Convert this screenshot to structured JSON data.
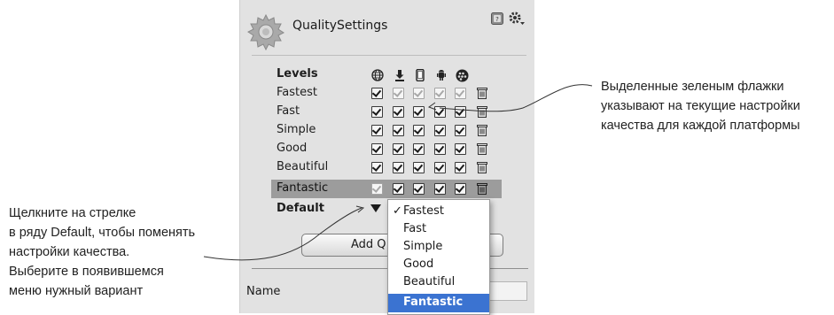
{
  "inspector": {
    "title": "QualitySettings",
    "levels_header": "Levels",
    "platform_icons": [
      "web-player-icon",
      "standalone-download-icon",
      "iphone-icon",
      "android-icon",
      "blackberry-icon"
    ],
    "levels": [
      {
        "name": "Fastest",
        "checks": [
          true,
          false,
          false,
          false,
          false
        ]
      },
      {
        "name": "Fast",
        "checks": [
          true,
          true,
          true,
          true,
          true
        ]
      },
      {
        "name": "Simple",
        "checks": [
          true,
          true,
          true,
          true,
          true
        ]
      },
      {
        "name": "Good",
        "checks": [
          true,
          true,
          true,
          true,
          true
        ]
      },
      {
        "name": "Beautiful",
        "checks": [
          true,
          true,
          true,
          true,
          true
        ]
      },
      {
        "name": "Fantastic",
        "checks": [
          false,
          true,
          true,
          true,
          true
        ],
        "highlighted": true
      }
    ],
    "default_label": "Default",
    "add_button_label": "Add Q",
    "name_label": "Name"
  },
  "dropdown": {
    "options": [
      "Fastest",
      "Fast",
      "Simple",
      "Good",
      "Beautiful",
      "Fantastic"
    ],
    "checked": "Fastest",
    "highlighted": "Fantastic",
    "checkmark": "✓",
    "highlight_color": "#3b73d1"
  },
  "annotations": {
    "right": [
      "Выделенные зеленым флажки",
      "указывают на текущие настройки",
      "качества для каждой платформы"
    ],
    "left": [
      "Щелкните на стрелке",
      "в ряду Default, чтобы поменять",
      "настройки качества.",
      "Выберите в появившемся",
      "меню нужный вариант"
    ]
  }
}
